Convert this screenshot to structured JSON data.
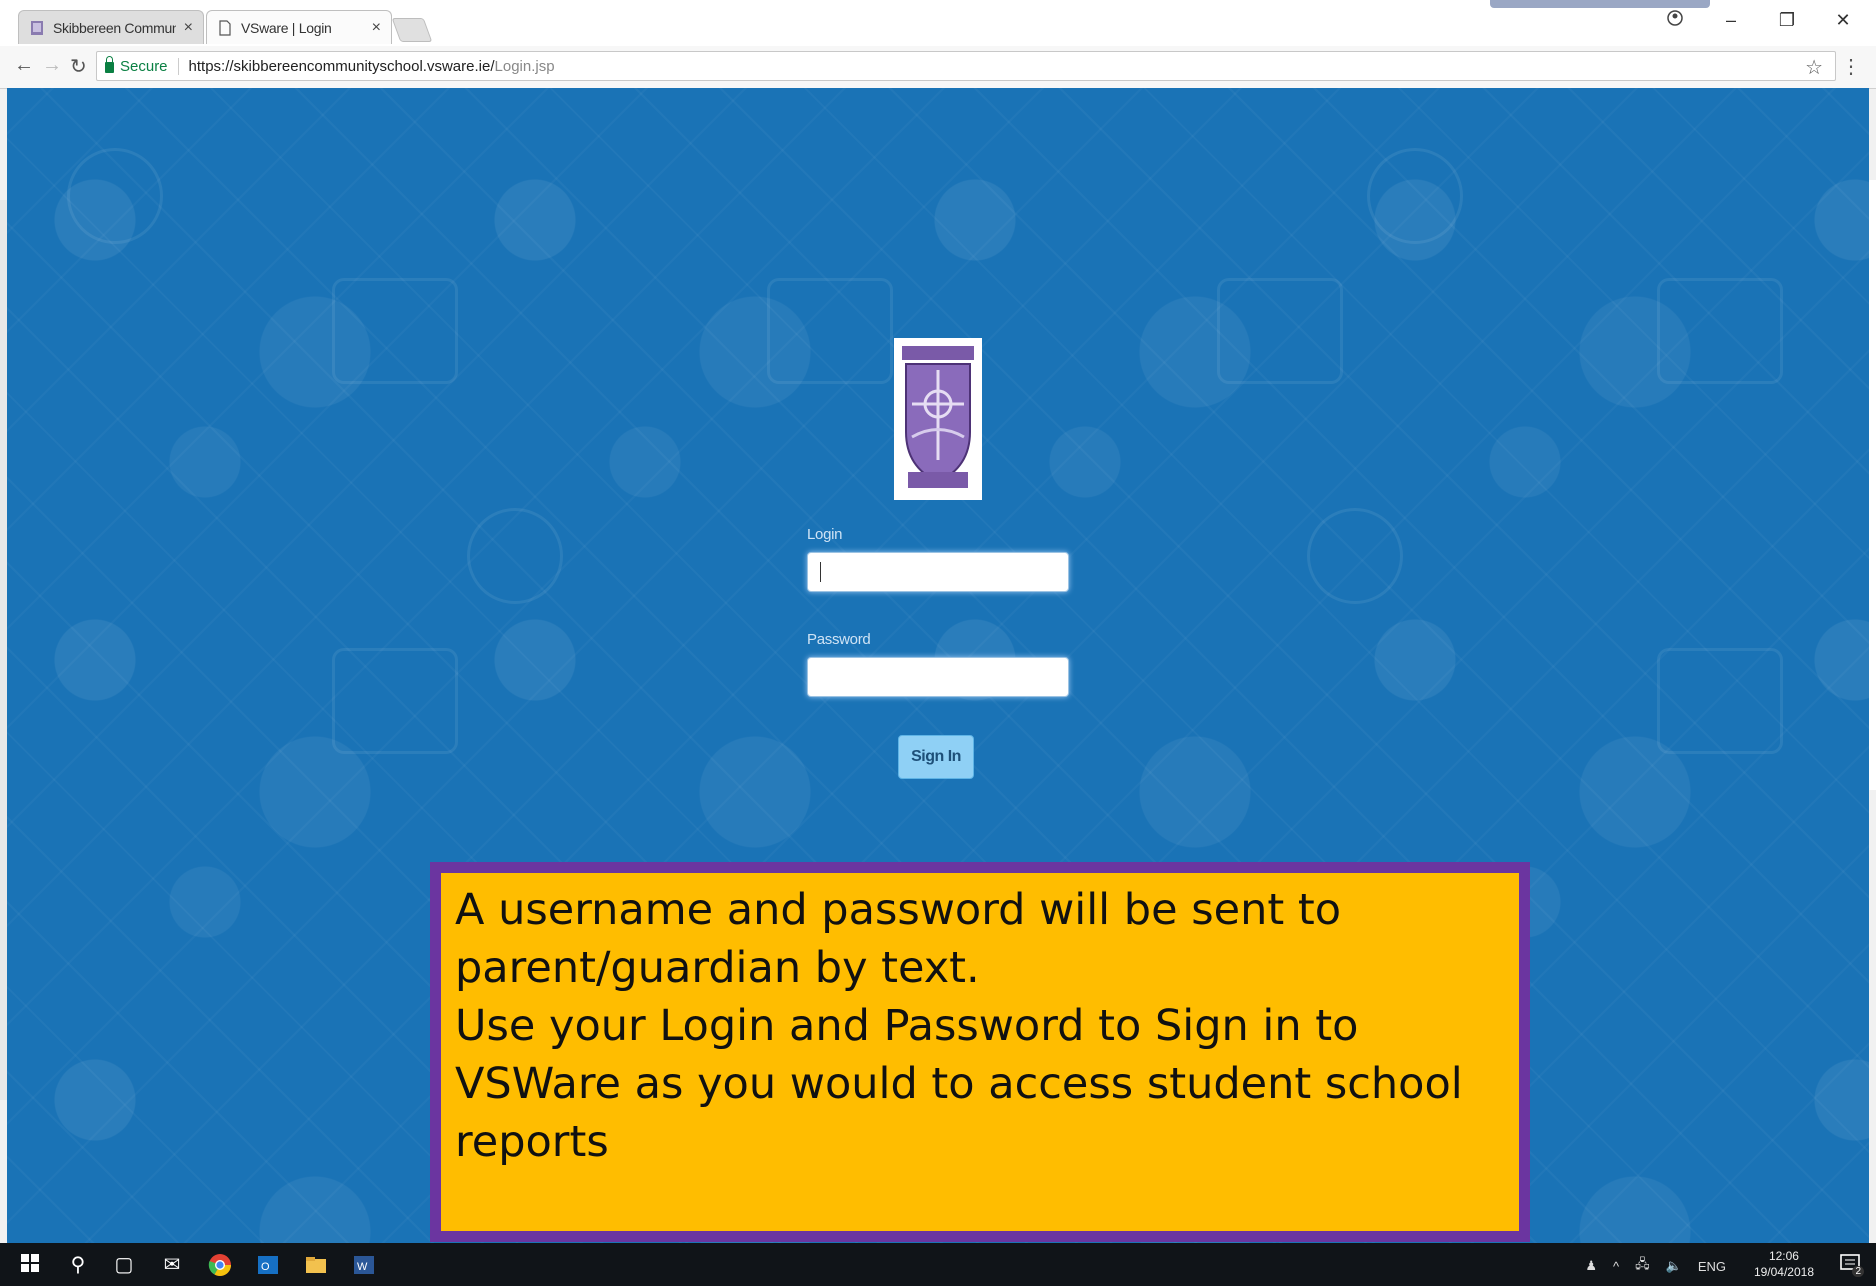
{
  "browser": {
    "tabs": [
      {
        "title": "Skibbereen Community S",
        "active": false
      },
      {
        "title": "VSware | Login",
        "active": true
      }
    ],
    "secure_label": "Secure",
    "url_host": "https://skibbereencommunityschool.vsware.ie/",
    "url_path": "Login.jsp"
  },
  "login_page": {
    "login_label": "Login",
    "password_label": "Password",
    "login_value": "",
    "password_value": "",
    "sign_in_label": "Sign In",
    "background_color": "#1a73b6"
  },
  "note": {
    "lines": [
      "A username and password will be sent to",
      "parent/guardian by text.",
      "Use your Login and Password to Sign in to",
      "VSWare as you would to access student school",
      "reports"
    ],
    "fill_color": "#ffbd00",
    "border_color": "#6b35a0"
  },
  "taskbar": {
    "tray_language": "ENG",
    "time": "12:06",
    "date": "19/04/2018",
    "notification_count": "2"
  }
}
